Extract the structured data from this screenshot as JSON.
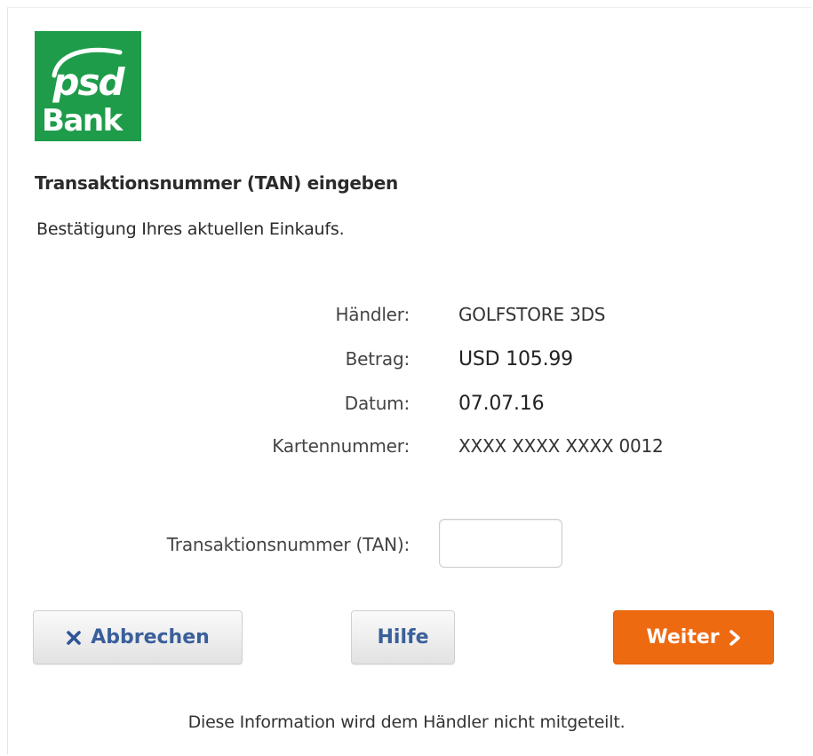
{
  "logo": {
    "line1": "psd",
    "line2": "Bank",
    "color": "#1e9c4a"
  },
  "header": {
    "title": "Transaktionsnummer (TAN) eingeben",
    "subtitle": "Bestätigung Ihres aktuellen Einkaufs."
  },
  "details": [
    {
      "label": "Händler:",
      "value": "GOLFSTORE 3DS"
    },
    {
      "label": "Betrag:",
      "value": "USD 105.99"
    },
    {
      "label": "Datum:",
      "value": "07.07.16"
    },
    {
      "label": "Kartennummer:",
      "value": "XXXX XXXX XXXX 0012"
    }
  ],
  "tan": {
    "label": "Transaktionsnummer (TAN):",
    "value": "",
    "placeholder": ""
  },
  "buttons": {
    "cancel": {
      "label": "Abbrechen",
      "icon": "close-icon"
    },
    "help": {
      "label": "Hilfe"
    },
    "next": {
      "label": "Weiter",
      "icon": "chevron-right-icon",
      "color": "#ee6a11"
    }
  },
  "footer": {
    "note": "Diese Information wird dem Händler nicht mitgeteilt."
  }
}
